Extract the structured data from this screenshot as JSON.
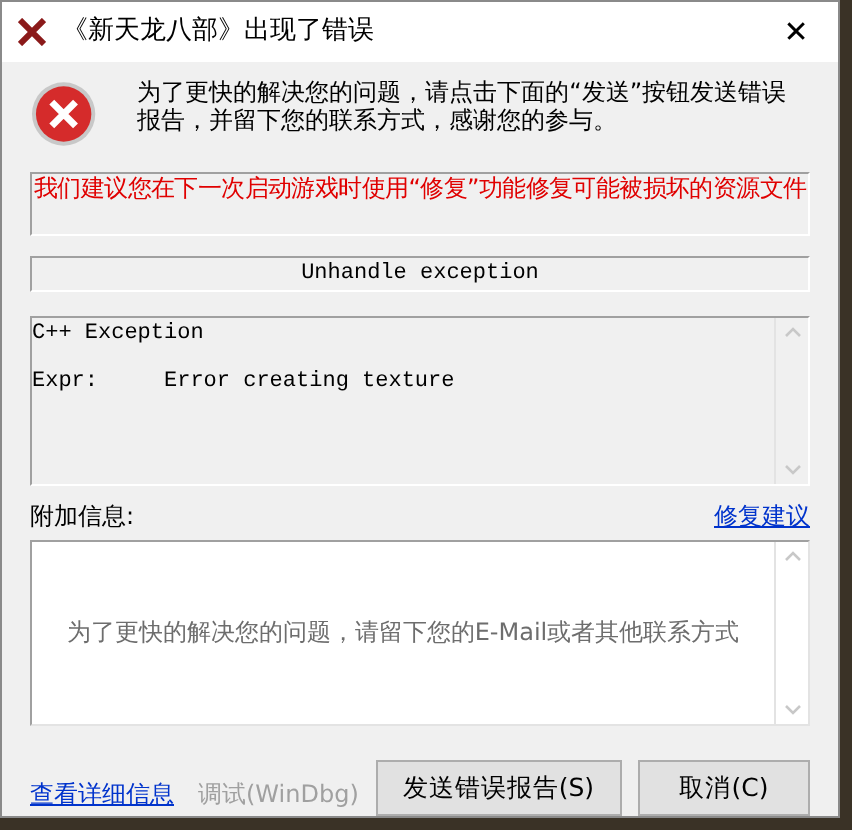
{
  "window": {
    "title": "《新天龙八部》出现了错误",
    "close": "✕"
  },
  "message": "为了更快的解决您的问题，请点击下面的“发送”按钮发送错误报告，并留下您的联系方式，感谢您的参与。",
  "warning": "我们建议您在下一次启动游戏时使用“修复”功能修复可能被损坏的资源文件",
  "exception_title": "Unhandle exception",
  "exception_details": {
    "lines": [
      {
        "label": "C++ Exception"
      },
      {
        "label": "Expr:",
        "value": "Error creating texture"
      }
    ]
  },
  "additional_info": {
    "label": "附加信息:",
    "link": "修复建议",
    "placeholder": "为了更快的解决您的问题，请留下您的E-Mail或者其他联系方式"
  },
  "footer": {
    "details_link": "查看详细信息",
    "buttons": [
      {
        "label": "调试(WinDbg)",
        "kind": "link",
        "disabled": true
      },
      {
        "label": "发送错误报告(S)",
        "kind": "button",
        "disabled": false
      },
      {
        "label": "取消(C)",
        "kind": "button",
        "disabled": false
      }
    ]
  }
}
